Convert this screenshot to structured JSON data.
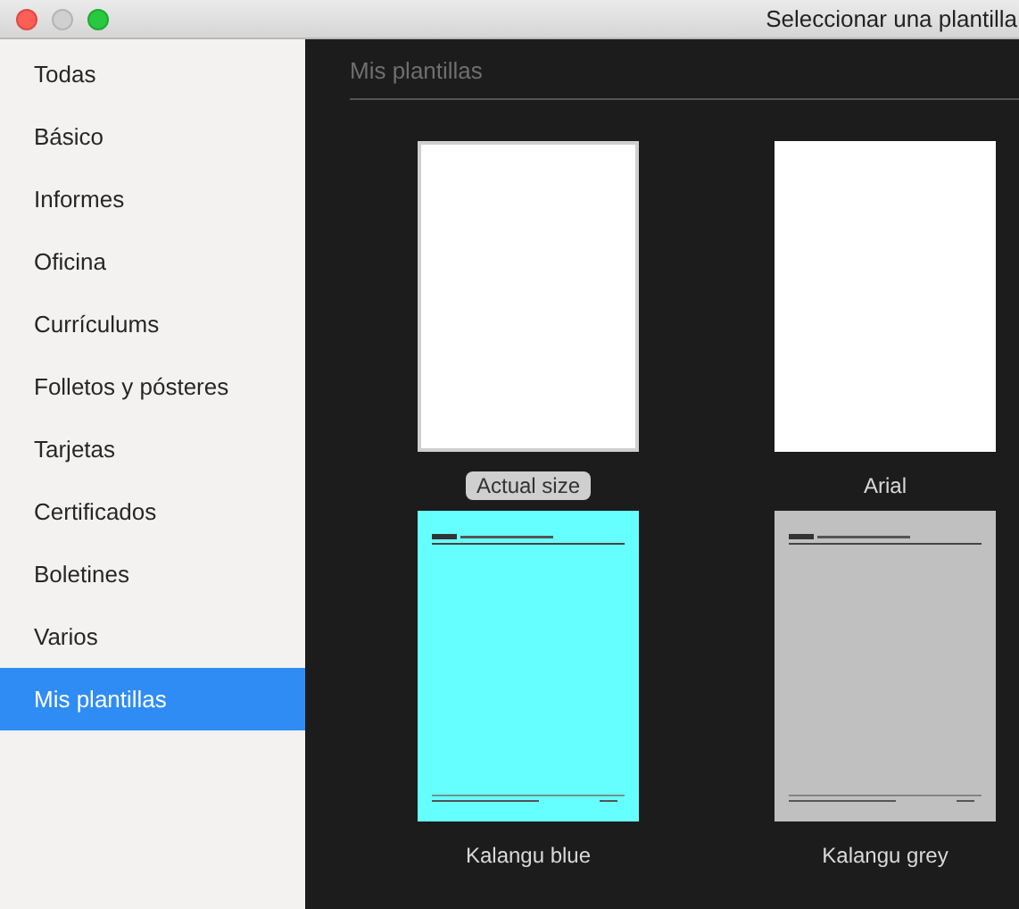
{
  "window": {
    "title": "Seleccionar una plantilla",
    "buttons": [
      {
        "kind": "close",
        "disabled": false
      },
      {
        "kind": "minimize",
        "disabled": true
      },
      {
        "kind": "zoom",
        "disabled": false
      }
    ]
  },
  "sidebar": {
    "items": [
      {
        "label": "Todas",
        "selected": false
      },
      {
        "label": "Básico",
        "selected": false
      },
      {
        "label": "Informes",
        "selected": false
      },
      {
        "label": "Oficina",
        "selected": false
      },
      {
        "label": "Currículums",
        "selected": false
      },
      {
        "label": "Folletos y pósteres",
        "selected": false
      },
      {
        "label": "Tarjetas",
        "selected": false
      },
      {
        "label": "Certificados",
        "selected": false
      },
      {
        "label": "Boletines",
        "selected": false
      },
      {
        "label": "Varios",
        "selected": false
      },
      {
        "label": "Mis plantillas",
        "selected": true
      }
    ]
  },
  "section": {
    "title": "Mis plantillas"
  },
  "templates": [
    {
      "name": "Actual size",
      "selected": true,
      "color": "#ffffff"
    },
    {
      "name": "Arial",
      "selected": false,
      "color": "#ffffff"
    },
    {
      "name": "Kalangu blue",
      "selected": false,
      "color": "#66ffff",
      "kind": "newsletter"
    },
    {
      "name": "Kalangu grey",
      "selected": false,
      "color": "#c0c0c0",
      "kind": "newsletter"
    }
  ]
}
